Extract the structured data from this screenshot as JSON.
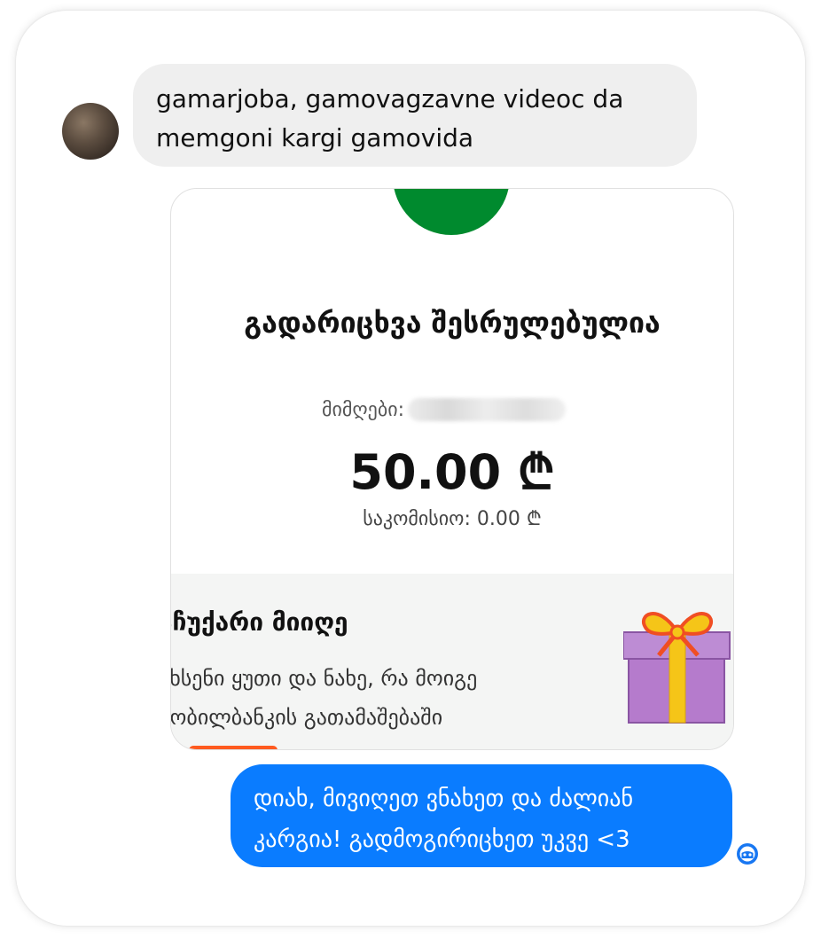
{
  "messages": {
    "incoming": {
      "text": "gamarjoba, gamovagzavne videoc da memgoni kargi gamovida",
      "avatar_icon": "user-avatar"
    },
    "outgoing": {
      "text": "დიახ, მივიღეთ ვნახეთ და ძალიან კარგია! გადმოგირიცხეთ უკვე <3",
      "bubble_color": "#0a7cff",
      "read_receipt_icon": "seen-avatar-icon"
    }
  },
  "receipt_card": {
    "status_icon": "success-circle",
    "status_color": "#008a2e",
    "title": "გადარიცხვა შესრულებულია",
    "recipient_label": "მიმღები:",
    "amount": "50.00 ₾",
    "commission": "საკომისიო: 0.00 ₾",
    "promo": {
      "title": "აჩუქარი მიიღე",
      "line1": "ახსენი ყუთი და ნახე, რა მოიგე",
      "line2": "მობილბანკის გათამაშებაში",
      "gift_icon": "gift-box-icon",
      "button_color": "#ff5a1f"
    }
  }
}
